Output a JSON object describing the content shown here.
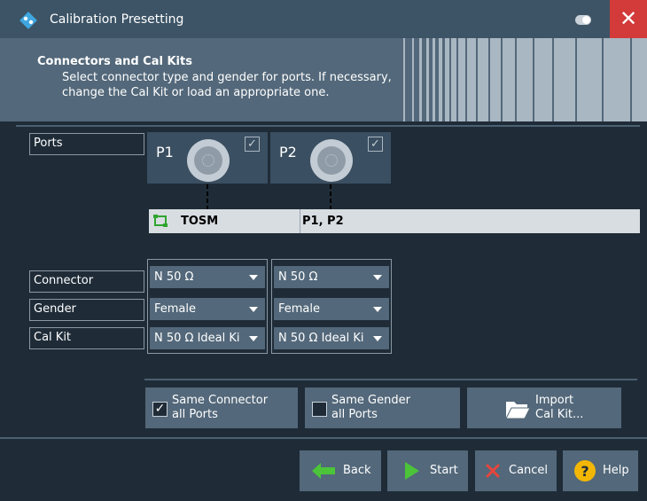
{
  "window": {
    "title": "Calibration Presetting",
    "close_glyph": "✕"
  },
  "header": {
    "title": "Connectors and Cal Kits",
    "description": "Select connector type and gender for ports. If necessary, change the Cal Kit or load an appropriate one."
  },
  "labels": {
    "ports": "Ports",
    "connector": "Connector",
    "gender": "Gender",
    "cal_kit": "Cal Kit"
  },
  "ports": [
    {
      "name": "P1",
      "checked": true,
      "connector": "N 50 Ω",
      "gender": "Female",
      "cal_kit": "N 50 Ω Ideal Ki"
    },
    {
      "name": "P2",
      "checked": true,
      "connector": "N 50 Ω",
      "gender": "Female",
      "cal_kit": "N 50 Ω Ideal Ki"
    }
  ],
  "calkit_bar": {
    "type": "TOSM",
    "ports": "P1, P2"
  },
  "options": {
    "same_connector": {
      "line1": "Same Connector",
      "line2": "all Ports",
      "checked": true
    },
    "same_gender": {
      "line1": "Same Gender",
      "line2": "all Ports",
      "checked": false
    },
    "import_calkit": {
      "line1": "Import",
      "line2": "Cal Kit..."
    }
  },
  "footer": {
    "back": "Back",
    "start": "Start",
    "cancel": "Cancel",
    "help": "Help"
  },
  "colors": {
    "background": "#1f2c38",
    "titlebar": "#3c5466",
    "header": "#53687a",
    "close": "#d33a3a",
    "green": "#4cc43a",
    "help_yellow": "#f2b705"
  },
  "icons": [
    "app-logo-icon",
    "toggle-icon",
    "close-icon",
    "port-connector-icon",
    "checkbox-icon",
    "calkit-icon",
    "dropdown-arrow-icon",
    "folder-icon",
    "back-arrow-icon",
    "play-icon",
    "cancel-x-icon",
    "help-icon"
  ]
}
